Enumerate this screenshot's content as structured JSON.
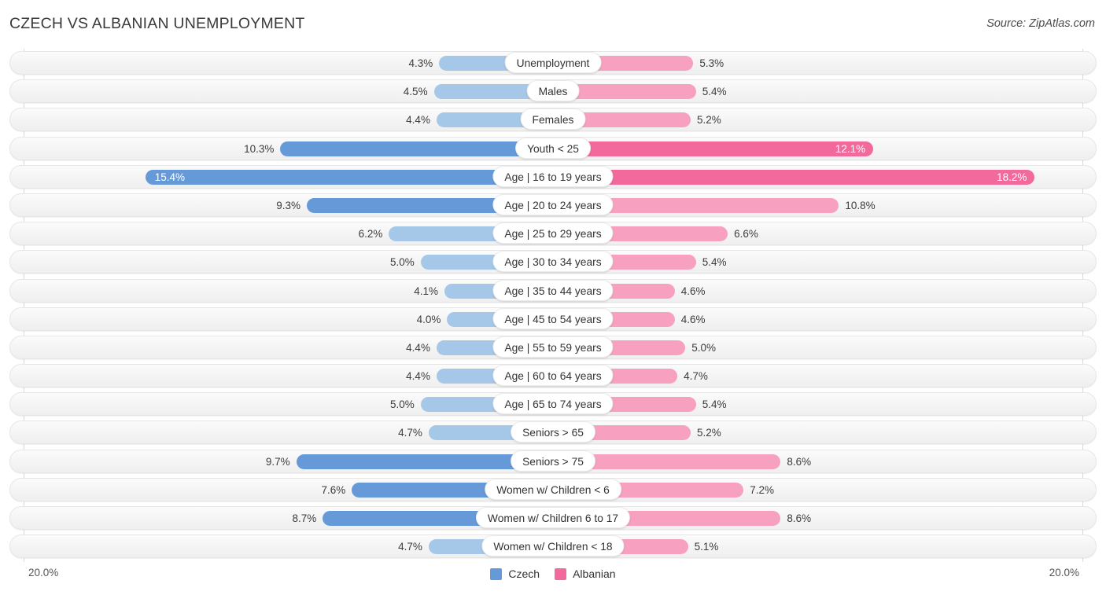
{
  "header": {
    "title": "CZECH VS ALBANIAN UNEMPLOYMENT",
    "source": "Source: ZipAtlas.com"
  },
  "footer": {
    "axis_left": "20.0%",
    "axis_right": "20.0%",
    "legend": [
      {
        "label": "Czech",
        "color": "#6699d8"
      },
      {
        "label": "Albanian",
        "color": "#f2699b"
      }
    ]
  },
  "colors": {
    "czech_light": "#a5c8e8",
    "czech_dark": "#6699d8",
    "albanian_light": "#f7a0c0",
    "albanian_dark": "#f2699b",
    "track": "#f3f3f3",
    "axis": "#d9d9d9"
  },
  "chart_data": {
    "type": "bar",
    "orientation": "horizontal-diverging",
    "title": "CZECH VS ALBANIAN UNEMPLOYMENT",
    "xlabel": "",
    "ylabel": "",
    "xlim": [
      20.0,
      20.0
    ],
    "grid": false,
    "legend_position": "bottom-center",
    "series": [
      {
        "name": "Czech",
        "side": "left",
        "values": [
          4.3,
          4.5,
          4.4,
          10.3,
          15.4,
          9.3,
          6.2,
          5.0,
          4.1,
          4.0,
          4.4,
          4.4,
          5.0,
          4.7,
          9.7,
          7.6,
          8.7,
          4.7
        ]
      },
      {
        "name": "Albanian",
        "side": "right",
        "values": [
          5.3,
          5.4,
          5.2,
          12.1,
          18.2,
          10.8,
          6.6,
          5.4,
          4.6,
          4.6,
          5.0,
          4.7,
          5.4,
          5.2,
          8.6,
          7.2,
          8.6,
          5.1
        ]
      }
    ],
    "categories": [
      "Unemployment",
      "Males",
      "Females",
      "Youth < 25",
      "Age | 16 to 19 years",
      "Age | 20 to 24 years",
      "Age | 25 to 29 years",
      "Age | 30 to 34 years",
      "Age | 35 to 44 years",
      "Age | 45 to 54 years",
      "Age | 55 to 59 years",
      "Age | 60 to 64 years",
      "Age | 65 to 74 years",
      "Seniors > 65",
      "Seniors > 75",
      "Women w/ Children < 6",
      "Women w/ Children 6 to 17",
      "Women w/ Children < 18"
    ],
    "rows": [
      {
        "label": "Unemployment",
        "left_value": 4.3,
        "left_text": "4.3%",
        "right_value": 5.3,
        "right_text": "5.3%",
        "highlight": false
      },
      {
        "label": "Males",
        "left_value": 4.5,
        "left_text": "4.5%",
        "right_value": 5.4,
        "right_text": "5.4%",
        "highlight": false
      },
      {
        "label": "Females",
        "left_value": 4.4,
        "left_text": "4.4%",
        "right_value": 5.2,
        "right_text": "5.2%",
        "highlight": false
      },
      {
        "label": "Youth < 25",
        "left_value": 10.3,
        "left_text": "10.3%",
        "right_value": 12.1,
        "right_text": "12.1%",
        "highlight": false
      },
      {
        "label": "Age | 16 to 19 years",
        "left_value": 15.4,
        "left_text": "15.4%",
        "right_value": 18.2,
        "right_text": "18.2%",
        "highlight": true
      },
      {
        "label": "Age | 20 to 24 years",
        "left_value": 9.3,
        "left_text": "9.3%",
        "right_value": 10.8,
        "right_text": "10.8%",
        "highlight": false
      },
      {
        "label": "Age | 25 to 29 years",
        "left_value": 6.2,
        "left_text": "6.2%",
        "right_value": 6.6,
        "right_text": "6.6%",
        "highlight": false
      },
      {
        "label": "Age | 30 to 34 years",
        "left_value": 5.0,
        "left_text": "5.0%",
        "right_value": 5.4,
        "right_text": "5.4%",
        "highlight": false
      },
      {
        "label": "Age | 35 to 44 years",
        "left_value": 4.1,
        "left_text": "4.1%",
        "right_value": 4.6,
        "right_text": "4.6%",
        "highlight": false
      },
      {
        "label": "Age | 45 to 54 years",
        "left_value": 4.0,
        "left_text": "4.0%",
        "right_value": 4.6,
        "right_text": "4.6%",
        "highlight": false
      },
      {
        "label": "Age | 55 to 59 years",
        "left_value": 4.4,
        "left_text": "4.4%",
        "right_value": 5.0,
        "right_text": "5.0%",
        "highlight": false
      },
      {
        "label": "Age | 60 to 64 years",
        "left_value": 4.4,
        "left_text": "4.4%",
        "right_value": 4.7,
        "right_text": "4.7%",
        "highlight": false
      },
      {
        "label": "Age | 65 to 74 years",
        "left_value": 5.0,
        "left_text": "5.0%",
        "right_value": 5.4,
        "right_text": "5.4%",
        "highlight": false
      },
      {
        "label": "Seniors > 65",
        "left_value": 4.7,
        "left_text": "4.7%",
        "right_value": 5.2,
        "right_text": "5.2%",
        "highlight": false
      },
      {
        "label": "Seniors > 75",
        "left_value": 9.7,
        "left_text": "9.7%",
        "right_value": 8.6,
        "right_text": "8.6%",
        "highlight": false
      },
      {
        "label": "Women w/ Children < 6",
        "left_value": 7.6,
        "left_text": "7.6%",
        "right_value": 7.2,
        "right_text": "7.2%",
        "highlight": false
      },
      {
        "label": "Women w/ Children 6 to 17",
        "left_value": 8.7,
        "left_text": "8.7%",
        "right_value": 8.6,
        "right_text": "8.6%",
        "highlight": false
      },
      {
        "label": "Women w/ Children < 18",
        "left_value": 4.7,
        "left_text": "4.7%",
        "right_value": 5.1,
        "right_text": "5.1%",
        "highlight": false
      }
    ]
  }
}
